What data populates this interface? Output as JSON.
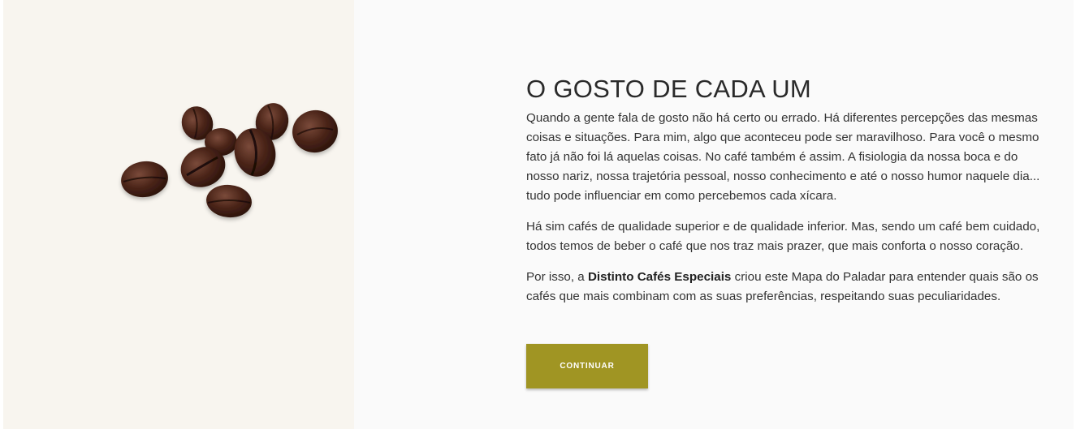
{
  "left_panel": {
    "image": "coffee-beans"
  },
  "main": {
    "title": "O GOSTO DE CADA UM",
    "paragraph1": "Quando a gente fala de gosto não há certo ou errado. Há diferentes percepções das mesmas coisas e situações. Para mim, algo que aconteceu pode ser maravilhoso. Para você o mesmo fato já não foi lá aquelas coisas. No café também é assim. A fisiologia da nossa boca e do nosso nariz, nossa trajetória pessoal, nosso conhecimento e até o nosso humor naquele dia... tudo pode influenciar em como percebemos cada xícara.",
    "paragraph2": "Há sim cafés de qualidade superior e de qualidade inferior. Mas, sendo um café bem cuidado, todos temos de beber o café que nos traz mais prazer, que mais conforta o nosso coração.",
    "paragraph3_prefix": "Por isso, a ",
    "paragraph3_brand": "Distinto Cafés Especiais",
    "paragraph3_suffix": " criou este Mapa do Paladar para entender quais são os cafés que mais combinam com as suas preferências, respeitando suas peculiaridades.",
    "continue_label": "CONTINUAR"
  },
  "colors": {
    "accent": "#a09523",
    "left_bg": "#f8f5ef",
    "right_bg": "#fafafa"
  }
}
